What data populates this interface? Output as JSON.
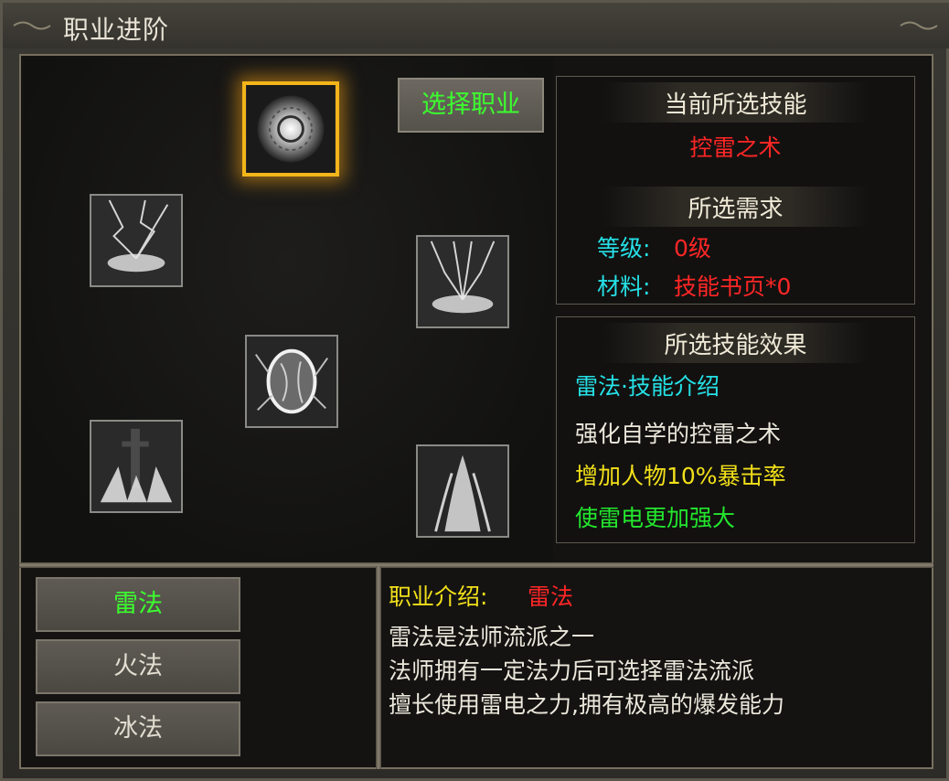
{
  "window": {
    "title": "职业进阶"
  },
  "select_job_button": "选择职业",
  "current_skill": {
    "header": "当前所选技能",
    "name": "控雷之术"
  },
  "requirements": {
    "header": "所选需求",
    "level_label": "等级:",
    "level_value": "0级",
    "material_label": "材料:",
    "material_value": "技能书页*0"
  },
  "effects": {
    "header": "所选技能效果",
    "intro": "雷法·技能介绍",
    "lines": [
      "强化自学的控雷之术",
      "增加人物10%暴击率",
      "使雷电更加强大"
    ]
  },
  "schools": [
    {
      "label": "雷法",
      "active": true
    },
    {
      "label": "火法",
      "active": false
    },
    {
      "label": "冰法",
      "active": false
    }
  ],
  "job_intro": {
    "label": "职业介绍:",
    "name": "雷法",
    "lines": [
      "雷法是法师流派之一",
      "法师拥有一定法力后可选择雷法流派",
      "擅长使用雷电之力,拥有极高的爆发能力"
    ]
  },
  "skills": [
    {
      "icon": "radiant-orb-icon",
      "selected": true
    },
    {
      "icon": "lightning-strike-icon",
      "selected": false
    },
    {
      "icon": "lightning-tree-icon",
      "selected": false
    },
    {
      "icon": "thunder-egg-icon",
      "selected": false
    },
    {
      "icon": "thunder-sword-icon",
      "selected": false
    },
    {
      "icon": "thunder-burst-icon",
      "selected": false
    }
  ],
  "colors": {
    "accent_green": "#3bff2e",
    "red": "#ff2626",
    "cyan": "#25e1e6",
    "yellow": "#f2e019",
    "green": "#23e62d",
    "selection_gold": "#f2b51a"
  }
}
